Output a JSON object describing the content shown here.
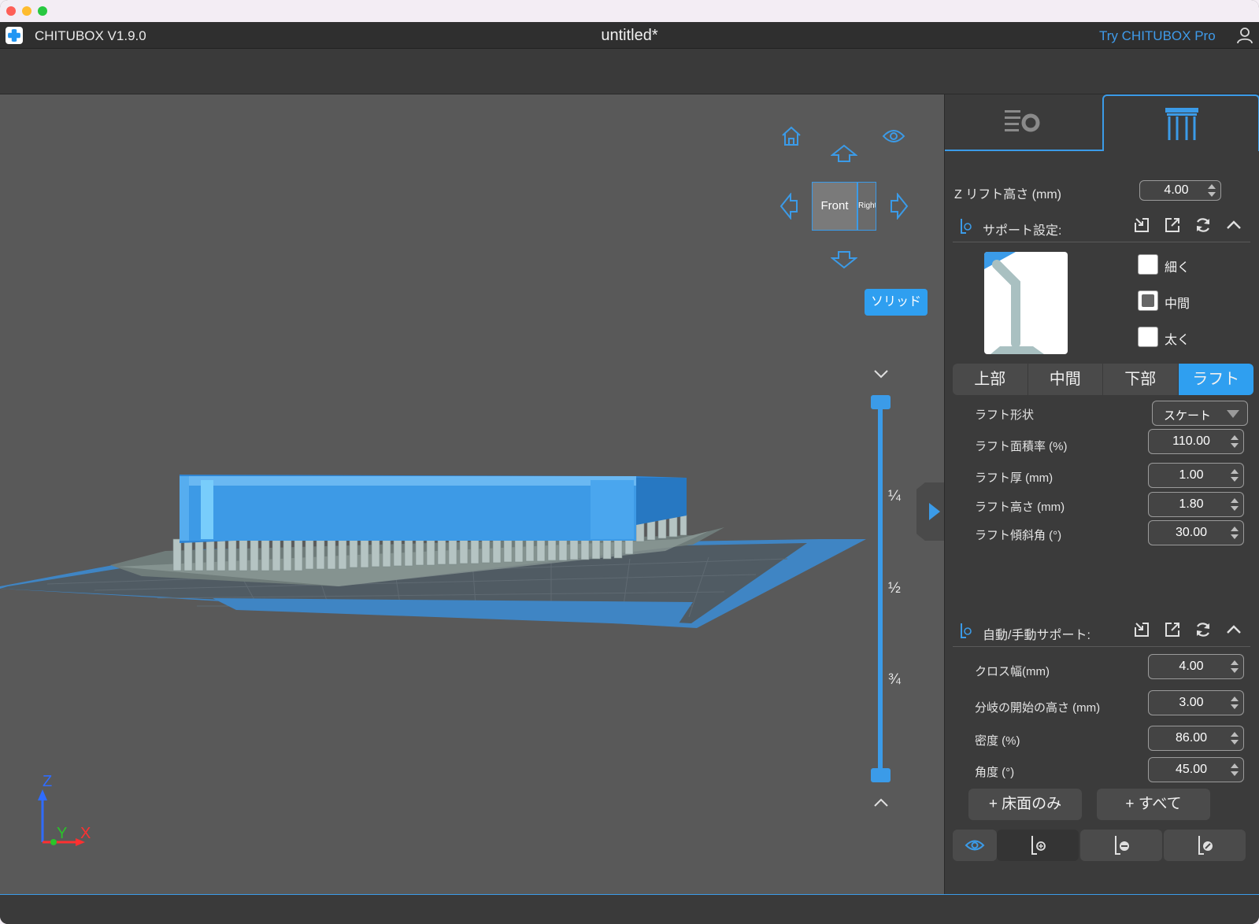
{
  "app": {
    "name": "CHITUBOX V1.9.0",
    "document_title": "untitled*",
    "pro_link": "Try CHITUBOX Pro"
  },
  "viewport": {
    "view_cube_front": "Front",
    "view_cube_side": "Right",
    "render_mode_button": "ソリッド",
    "z_ticks": [
      "¼",
      "½",
      "¾"
    ],
    "axis_labels": {
      "z": "Z",
      "y": "Y",
      "x": "X"
    }
  },
  "panel": {
    "z_lift_label": "Z リフト高さ (mm)",
    "z_lift_value": "4.00",
    "support_settings": {
      "title": "サポート設定:",
      "options": [
        {
          "label": "細く",
          "checked": false
        },
        {
          "label": "中間",
          "checked": true
        },
        {
          "label": "太く",
          "checked": false
        }
      ],
      "tabs": [
        "上部",
        "中間",
        "下部",
        "ラフト"
      ],
      "active_tab": "ラフト",
      "fields": {
        "raft_shape_label": "ラフト形状",
        "raft_shape_value": "スケート",
        "raft_area_label": "ラフト面積率 (%)",
        "raft_area_value": "110.00",
        "raft_thickness_label": "ラフト厚 (mm)",
        "raft_thickness_value": "1.00",
        "raft_height_label": "ラフト高さ (mm)",
        "raft_height_value": "1.80",
        "raft_slope_label": "ラフト傾斜角 (°)",
        "raft_slope_value": "30.00"
      }
    },
    "auto_support": {
      "title": "自動/手動サポート:",
      "cross_width_label": "クロス幅(mm)",
      "cross_width_value": "4.00",
      "branch_height_label": "分岐の開始の高さ (mm)",
      "branch_height_value": "3.00",
      "density_label": "密度 (%)",
      "density_value": "86.00",
      "angle_label": "角度 (°)",
      "angle_value": "45.00",
      "floor_only_button": "+ 床面のみ",
      "all_button": "+ すべて"
    }
  },
  "colors": {
    "accent": "#2f9ff0",
    "model": "#3d9ae6",
    "supports": "#b5c4c3"
  },
  "icons": [
    "home-icon",
    "eye-icon",
    "arrow-up-icon",
    "arrow-left-icon",
    "arrow-right-icon",
    "arrow-down-icon",
    "settings-list-icon",
    "support-columns-icon",
    "import-icon",
    "export-icon",
    "reset-icon",
    "chevron-up-icon",
    "chevron-down-icon",
    "user-icon"
  ]
}
